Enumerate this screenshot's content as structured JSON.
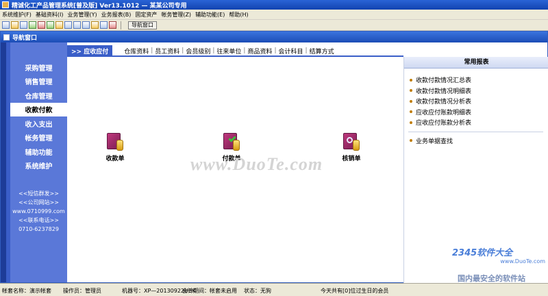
{
  "app": {
    "title": "精诚化工产品管理系统[普及版] Ver13.1012 — 某某公司专用"
  },
  "menubar": {
    "items": [
      "系统维护(F)",
      "基础资料(I)",
      "业务管理(Y)",
      "业务报表(B)",
      "固定资产",
      "帐务管理(Z)",
      "辅助功能(E)",
      "帮助(H)"
    ]
  },
  "toolbar": {
    "nav_window_label": "导航窗口",
    "icons": [
      "new-icon",
      "open-icon",
      "list-icon",
      "report-icon",
      "chart-icon",
      "user-icon",
      "tool-icon",
      "edit-icon",
      "print-icon",
      "save-icon",
      "calc-icon",
      "help-icon",
      "exit-icon"
    ]
  },
  "nav_window": {
    "title": "导航窗口"
  },
  "sidebar": {
    "items": [
      {
        "label": "采购管理"
      },
      {
        "label": "销售管理"
      },
      {
        "label": "仓库管理"
      },
      {
        "label": "收款付款"
      },
      {
        "label": "收入支出"
      },
      {
        "label": "帐务管理"
      },
      {
        "label": "辅助功能"
      },
      {
        "label": "系统维护"
      }
    ],
    "active_index": 3,
    "contact": {
      "sms": "<<短信群发>>",
      "website_label": "<<公司网站>>",
      "website": "www.0710999.com",
      "phone_label": "<<联系电话>>",
      "phone": "0710-6237829"
    }
  },
  "main": {
    "active_tab": ">> 应收应付",
    "tabs": [
      "仓库资料",
      "员工资料",
      "会员级别",
      "往来单位",
      "商品资料",
      "会计科目",
      "结算方式"
    ],
    "tiles": [
      {
        "label": "收款单"
      },
      {
        "label": "付款单"
      },
      {
        "label": "核销单"
      }
    ],
    "watermark": "www.DuoTe.com"
  },
  "right_panel": {
    "title": "常用报表",
    "reports": [
      "收款付款情况汇总表",
      "收款付款情况明细表",
      "收款付款情况分析表",
      "应收应付账款明细表",
      "应收应付账款分析表"
    ],
    "extra": [
      "业务单据查找"
    ]
  },
  "brand_watermark": {
    "logo": "2345软件大全",
    "url": "www.DuoTe.com",
    "tagline": "国内最安全的软件站"
  },
  "statusbar": {
    "account": "帐套名称：演示帐套",
    "operator": "操作员：管理员",
    "machine": "机器号：XP—20130922UBK",
    "period": "会计期间：帐套未启用",
    "status": "状态：无狗",
    "birthday": "今天共有[0]位过生日的会员"
  }
}
